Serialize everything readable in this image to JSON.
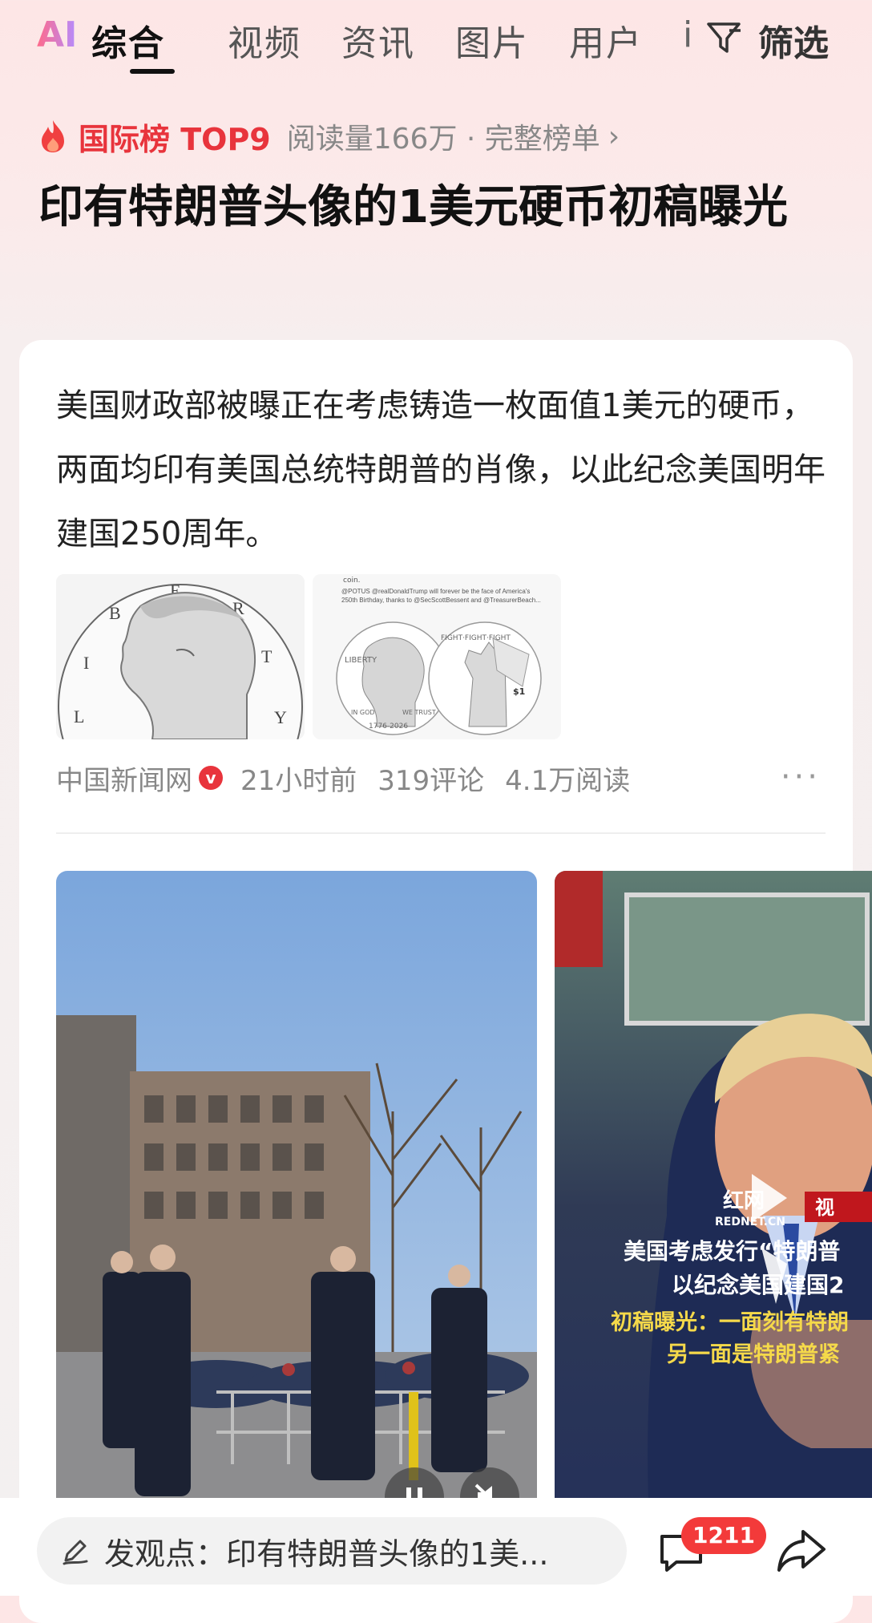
{
  "tabs": {
    "ai": "AI",
    "items": [
      "综合",
      "视频",
      "资讯",
      "图片",
      "用户"
    ],
    "cutoff": "i",
    "filter": "筛选"
  },
  "hot": {
    "rank": "国际榜 TOP9",
    "meta": "阅读量166万 · 完整榜单",
    "chevron": "›"
  },
  "headline": "印有特朗普头像的1美元硬币初稿曝光",
  "card": {
    "summary": "美国财政部被曝正在考虑铸造一枚面值1美元的硬币，两面均印有美国总统特朗普的肖像，以此纪念美国明年建国250周年。",
    "source": "中国新闻网",
    "verified": "v",
    "time": "21小时前",
    "comments": "319评论",
    "reads": "4.1万阅读",
    "more": "···"
  },
  "thumb1": {
    "letters": [
      "L",
      "I",
      "B",
      "E",
      "R",
      "T",
      "Y"
    ]
  },
  "thumb2": {
    "caption_top": "coin.",
    "tweet": "@POTUS @realDonaldTrump will forever be the face of America's 250th Birthday, thanks to @SecScottBessent and @TreasurerBeach...",
    "liberty": "LIBERTY",
    "fight": "FIGHT·FIGHT·FIGHT",
    "in_god": "IN GOD",
    "we_trust": "WE TRUST",
    "years": "1776-2026",
    "dollar": "$1"
  },
  "video2": {
    "logo": "红网",
    "site": "REDNET.CN",
    "tag": "视",
    "title1": "美国考虑发行“特朗普",
    "title2": "以纪念美国建国2",
    "sub1": "初稿曝光：一面刻有特朗",
    "sub2": "另一面是特朗普紧"
  },
  "bottom": {
    "comment_placeholder": "发观点：印有特朗普头像的1美...",
    "comment_count": "1211"
  },
  "colors": {
    "accent_red": "#e8343c",
    "badge_red": "#f33a3a"
  }
}
